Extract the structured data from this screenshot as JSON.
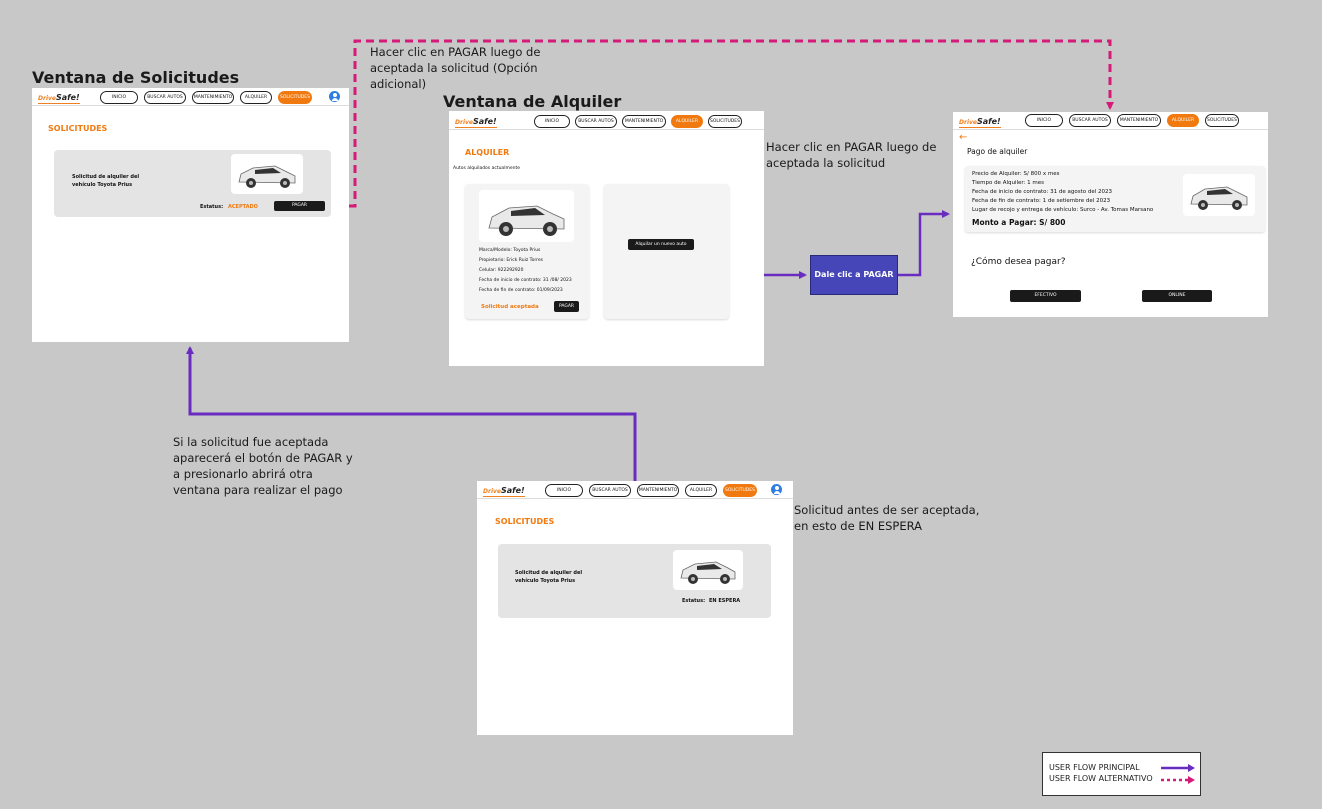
{
  "solicitudes_window": {
    "title": "Ventana de Solicitudes",
    "logo": {
      "drive": "Drive",
      "safe": "Safe!"
    },
    "nav": [
      "INICIO",
      "BUSCAR AUTOS",
      "MANTENIMIENTO",
      "ALQUILER",
      "SOLICITUDES"
    ],
    "heading": "SOLICITUDES",
    "card_title_line1": "Solicitud de alquiler del",
    "card_title_line2": "vehículo Toyota Prius",
    "status_label": "Estatus:",
    "status_value": "ACEPTADO",
    "pay_button": "PAGAR"
  },
  "alquiler_window": {
    "title": "Ventana de Alquiler",
    "logo": {
      "drive": "Drive",
      "safe": "Safe!"
    },
    "nav": [
      "INICIO",
      "BUSCAR AUTOS",
      "MANTENIMIENTO",
      "ALQUILER",
      "SOLICITUDES"
    ],
    "heading": "ALQUILER",
    "subheading": "Autos alquilados actualmente",
    "details": [
      "Marca/Modelo: Toyota Prius",
      "Propietario: Erick Ruiz Torres",
      "Celular: 922292920",
      "Fecha de inicio de contrato: 31 /08/ 2023",
      "Fecha de fin de contrato: 01/09/2023"
    ],
    "status": "Solicitud aceptada",
    "pay_button": "PAGAR",
    "new_car_button": "Alquilar un nuevo auto"
  },
  "pago_window": {
    "logo": {
      "drive": "Drive",
      "safe": "Safe!"
    },
    "nav": [
      "INICIO",
      "BUSCAR AUTOS",
      "MANTENIMIENTO",
      "ALQUILER",
      "SOLICITUDES"
    ],
    "back_arrow": "←",
    "heading": "Pago de alquiler",
    "details": [
      "Precio de Alquiler: S/ 800 x mes",
      "Tiempo de Alquiler: 1 mes",
      "Fecha de inicio de contrato: 31 de agosto del 2023",
      "Fecha de fin de contrato: 1 de setiembre del 2023",
      "Lugar de recojo y entrega de vehículo: Surco - Av. Tomas Marsano"
    ],
    "total": "Monto a Pagar:  S/ 800",
    "question": "¿Cómo desea pagar?",
    "option_cash": "EFECTIVO",
    "option_online": "ONLINE"
  },
  "espera_window": {
    "logo": {
      "drive": "Drive",
      "safe": "Safe!"
    },
    "nav": [
      "INICIO",
      "BUSCAR AUTOS",
      "MANTENIMIENTO",
      "ALQUILER",
      "SOLICITUDES"
    ],
    "heading": "SOLICITUDES",
    "card_title_line1": "Solicitud de alquiler del",
    "card_title_line2": "vehículo Toyota Prius",
    "status_label": "Estatus:",
    "status_value": "EN ESPERA"
  },
  "annotations": {
    "alt_flow_line1": "Hacer clic en PAGAR luego de",
    "alt_flow_line2": "aceptada la solicitud (Opción",
    "alt_flow_line3": "adicional)",
    "main_click_line1": "Hacer clic en PAGAR luego de",
    "main_click_line2": "aceptada la solicitud",
    "step_box": "Dale clic a PAGAR",
    "accepted_line1": "Si la solicitud fue aceptada",
    "accepted_line2": "aparecerá el botón de PAGAR  y",
    "accepted_line3": "a presionarlo abrirá otra",
    "accepted_line4": "ventana para realizar el pago",
    "pending_line1": "Solicitud antes de ser aceptada,",
    "pending_line2": "en esto de EN ESPERA"
  },
  "legend": {
    "main": "USER FLOW PRINCIPAL",
    "alt": "USER FLOW ALTERNATIVO"
  },
  "colors": {
    "background": "#c8c8c8",
    "main_flow": "#6a2cc0",
    "alt_flow": "#d61a78",
    "accent_orange": "#f07a10",
    "step_box": "#4646b8"
  }
}
